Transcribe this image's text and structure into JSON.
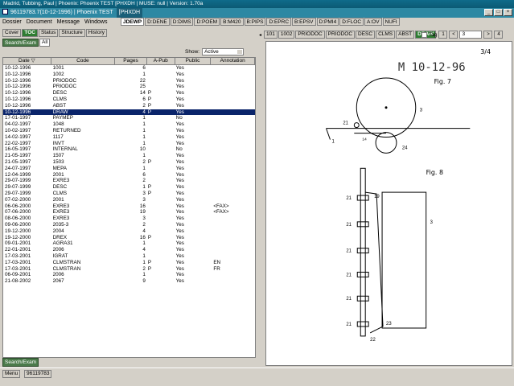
{
  "window": {
    "title": "Madrid, Tubbing, Paul | Phoenix: Phoenix TEST    [PHXDH | MUSE: null | Version: 1.70a",
    "case_id": "96119783.7(10-12-1996) | Phoenix TEST",
    "process": "[PHXDH"
  },
  "menu": [
    "Dossier",
    "Document",
    "Message",
    "Windows"
  ],
  "doc_tabs": [
    {
      "label": "JDEWP",
      "active": true
    },
    {
      "label": "D:DENE",
      "active": false
    },
    {
      "label": "D:DIMS",
      "active": false
    },
    {
      "label": "D:POEM",
      "active": false
    },
    {
      "label": "B:M420",
      "active": false
    },
    {
      "label": "B:PIPS",
      "active": false
    },
    {
      "label": "D:EPRC",
      "active": false
    },
    {
      "label": "B:EPSV",
      "active": false
    },
    {
      "label": "D:PMI4",
      "active": false
    },
    {
      "label": "D:FLOC",
      "active": false
    },
    {
      "label": "A:OV",
      "active": false
    },
    {
      "label": "NUFI",
      "active": false
    }
  ],
  "left_tabs": [
    {
      "label": "Cover",
      "active": false
    },
    {
      "label": "TOC",
      "active": true
    },
    {
      "label": "Status",
      "active": false
    },
    {
      "label": "Structure",
      "active": false
    },
    {
      "label": "History",
      "active": false
    }
  ],
  "search_label": "Search/Exam",
  "all_label": "All",
  "show": {
    "label": "Show:",
    "value": "Active"
  },
  "table": {
    "headers": [
      "Date ▽",
      "Code",
      "Pages",
      "A-Pub",
      "Public",
      "Annotation"
    ],
    "rows": [
      [
        "10-12-1996",
        "1001",
        "6",
        "",
        "Yes",
        ""
      ],
      [
        "10-12-1996",
        "1002",
        "1",
        "",
        "Yes",
        ""
      ],
      [
        "10-12-1996",
        "PRIODOC",
        "22",
        "",
        "Yes",
        ""
      ],
      [
        "10-12-1996",
        "PRIODOC",
        "25",
        "",
        "Yes",
        ""
      ],
      [
        "10-12-1996",
        "DESC",
        "14",
        "P",
        "Yes",
        ""
      ],
      [
        "10-12-1996",
        "CLMS",
        "6",
        "P",
        "Yes",
        ""
      ],
      [
        "10-12-1996",
        "ABST",
        "2",
        "P",
        "Yes",
        ""
      ],
      [
        "10-12-1996",
        "DRAW",
        "4",
        "P",
        "Yes",
        ""
      ],
      [
        "17-01-1997",
        "PAYMEP",
        "1",
        "",
        "No",
        ""
      ],
      [
        "04-02-1997",
        "1048",
        "1",
        "",
        "Yes",
        ""
      ],
      [
        "10-02-1997",
        "RETURNED",
        "1",
        "",
        "Yes",
        ""
      ],
      [
        "14-02-1997",
        "1117",
        "1",
        "",
        "Yes",
        ""
      ],
      [
        "22-02-1997",
        "INVT",
        "1",
        "",
        "Yes",
        ""
      ],
      [
        "16-05-1997",
        "INTERNAL",
        "10",
        "",
        "No",
        ""
      ],
      [
        "21-05-1997",
        "1507",
        "1",
        "",
        "Yes",
        ""
      ],
      [
        "21-05-1997",
        "1503",
        "2",
        "P",
        "Yes",
        ""
      ],
      [
        "24-07-1997",
        "MEPA",
        "1",
        "",
        "Yes",
        ""
      ],
      [
        "12-04-1999",
        "2001",
        "6",
        "",
        "Yes",
        ""
      ],
      [
        "29-07-1999",
        "EXRE3",
        "2",
        "",
        "Yes",
        ""
      ],
      [
        "29-07-1999",
        "DESC",
        "1",
        "P",
        "Yes",
        ""
      ],
      [
        "29-07-1999",
        "CLMS",
        "3",
        "P",
        "Yes",
        ""
      ],
      [
        "07-02-2000",
        "2001",
        "3",
        "",
        "Yes",
        ""
      ],
      [
        "06-06-2000",
        "EXRE3",
        "16",
        "",
        "Yes",
        "<FAX>"
      ],
      [
        "07-06-2000",
        "EXRE3",
        "19",
        "",
        "Yes",
        "<FAX>"
      ],
      [
        "08-06-2000",
        "EXRE3",
        "3",
        "",
        "Yes",
        ""
      ],
      [
        "09-06-2000",
        "2035-3",
        "2",
        "",
        "Yes",
        ""
      ],
      [
        "19-12-2000",
        "2004",
        "4",
        "",
        "Yes",
        ""
      ],
      [
        "19-12-2000",
        "DREX",
        "16",
        "P",
        "Yes",
        ""
      ],
      [
        "09-01-2001",
        "AGRA31",
        "1",
        "",
        "Yes",
        ""
      ],
      [
        "22-01-2001",
        "2006",
        "4",
        "",
        "Yes",
        ""
      ],
      [
        "17-03-2001",
        "IGRAT",
        "1",
        "",
        "Yes",
        ""
      ],
      [
        "17-03-2001",
        "CLMSTRAN",
        "1",
        "P",
        "Yes",
        "EN"
      ],
      [
        "17-03-2001",
        "CLMSTRAN",
        "2",
        "P",
        "Yes",
        "FR"
      ],
      [
        "06-09-2001",
        "2006",
        "1",
        "",
        "Yes",
        ""
      ],
      [
        "21-08-2002",
        "2067",
        "9",
        "",
        "Yes",
        ""
      ]
    ],
    "selected_row": 7
  },
  "right_tabs": [
    {
      "label": "101",
      "active": false
    },
    {
      "label": "1002",
      "active": false
    },
    {
      "label": "PRIODOC",
      "active": false
    },
    {
      "label": "PRIODOC",
      "active": false
    },
    {
      "label": "DESC",
      "active": false
    },
    {
      "label": "CLMS",
      "active": false
    },
    {
      "label": "ABST",
      "active": false
    },
    {
      "label": "DRAW",
      "active": true
    }
  ],
  "pager": {
    "tag_label": "Tag",
    "first": "1",
    "current": "3",
    "total": "4"
  },
  "drawing": {
    "stamp": "M 10-12-96",
    "page": "3/4",
    "fig7": "Fig. 7",
    "fig8": "Fig. 8",
    "refs": [
      "21",
      "3",
      "1",
      "14",
      "24",
      "19",
      "21",
      "21",
      "21",
      "21",
      "21",
      "21",
      "21",
      "3",
      "23",
      "22"
    ]
  },
  "status": {
    "search": "Search/Exam",
    "menu": "Menu",
    "case": "96119783"
  }
}
